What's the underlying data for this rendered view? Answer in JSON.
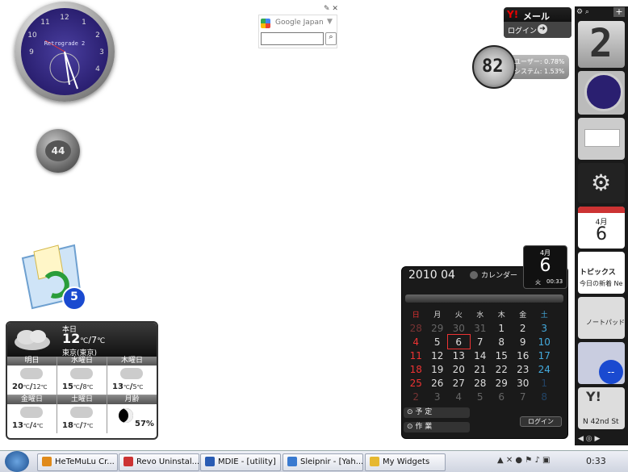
{
  "clock": {
    "label": "Retrograde 2"
  },
  "gauge": {
    "value": "44"
  },
  "recycle": {
    "count": "5"
  },
  "weather": {
    "today_label": "本日",
    "today_high": "12",
    "today_low": "7",
    "unit": "℃",
    "location": "東京(東京)",
    "forecast": [
      {
        "day": "明日",
        "high": "20",
        "low": "12"
      },
      {
        "day": "水曜日",
        "high": "15",
        "low": "8"
      },
      {
        "day": "木曜日",
        "high": "13",
        "low": "5"
      },
      {
        "day": "金曜日",
        "high": "13",
        "low": "4"
      },
      {
        "day": "土曜日",
        "high": "18",
        "low": "7"
      },
      {
        "day": "月齢",
        "value": "57%"
      }
    ]
  },
  "google": {
    "title": "Google Japan"
  },
  "ymail": {
    "title": "メール",
    "login": "ログイン"
  },
  "cpu": {
    "value": "82",
    "user": "ユーザー: 0.78%",
    "system": "システム: 1.53%"
  },
  "calendar": {
    "header": "2010 04",
    "label": "カレンダー",
    "weekdays": [
      "日",
      "月",
      "火",
      "水",
      "木",
      "金",
      "土"
    ],
    "weeks": [
      [
        "28",
        "29",
        "30",
        "31",
        "1",
        "2",
        "3"
      ],
      [
        "4",
        "5",
        "6",
        "7",
        "8",
        "9",
        "10"
      ],
      [
        "11",
        "12",
        "13",
        "14",
        "15",
        "16",
        "17"
      ],
      [
        "18",
        "19",
        "20",
        "21",
        "22",
        "23",
        "24"
      ],
      [
        "25",
        "26",
        "27",
        "28",
        "29",
        "30",
        "1"
      ],
      [
        "2",
        "3",
        "4",
        "5",
        "6",
        "7",
        "8"
      ]
    ],
    "today": "6",
    "schedule": "予 定",
    "task": "作 業",
    "login": "ログイン"
  },
  "date_tile": {
    "month": "4月",
    "day": "6",
    "weekday": "火",
    "time": "00:33"
  },
  "sidebar": {
    "digit": "2",
    "cal_month": "4月",
    "cal_day": "6",
    "topics": "トピックス",
    "topics_sub": "今日の新着 Ne",
    "notepad": "ノートパッド",
    "weather_badge": "--",
    "news": "N 42nd St"
  },
  "taskbar": {
    "items": [
      {
        "label": "HeTeMuLu Cr...",
        "color": "#e08a1a"
      },
      {
        "label": "Revo Uninstal...",
        "color": "#c33"
      },
      {
        "label": "MDIE - [utility]",
        "color": "#2a5cb3"
      },
      {
        "label": "Sleipnir - [Yah...",
        "color": "#3a7ad0"
      },
      {
        "label": "My Widgets",
        "color": "#e6b830"
      }
    ],
    "clock": "0:33"
  }
}
